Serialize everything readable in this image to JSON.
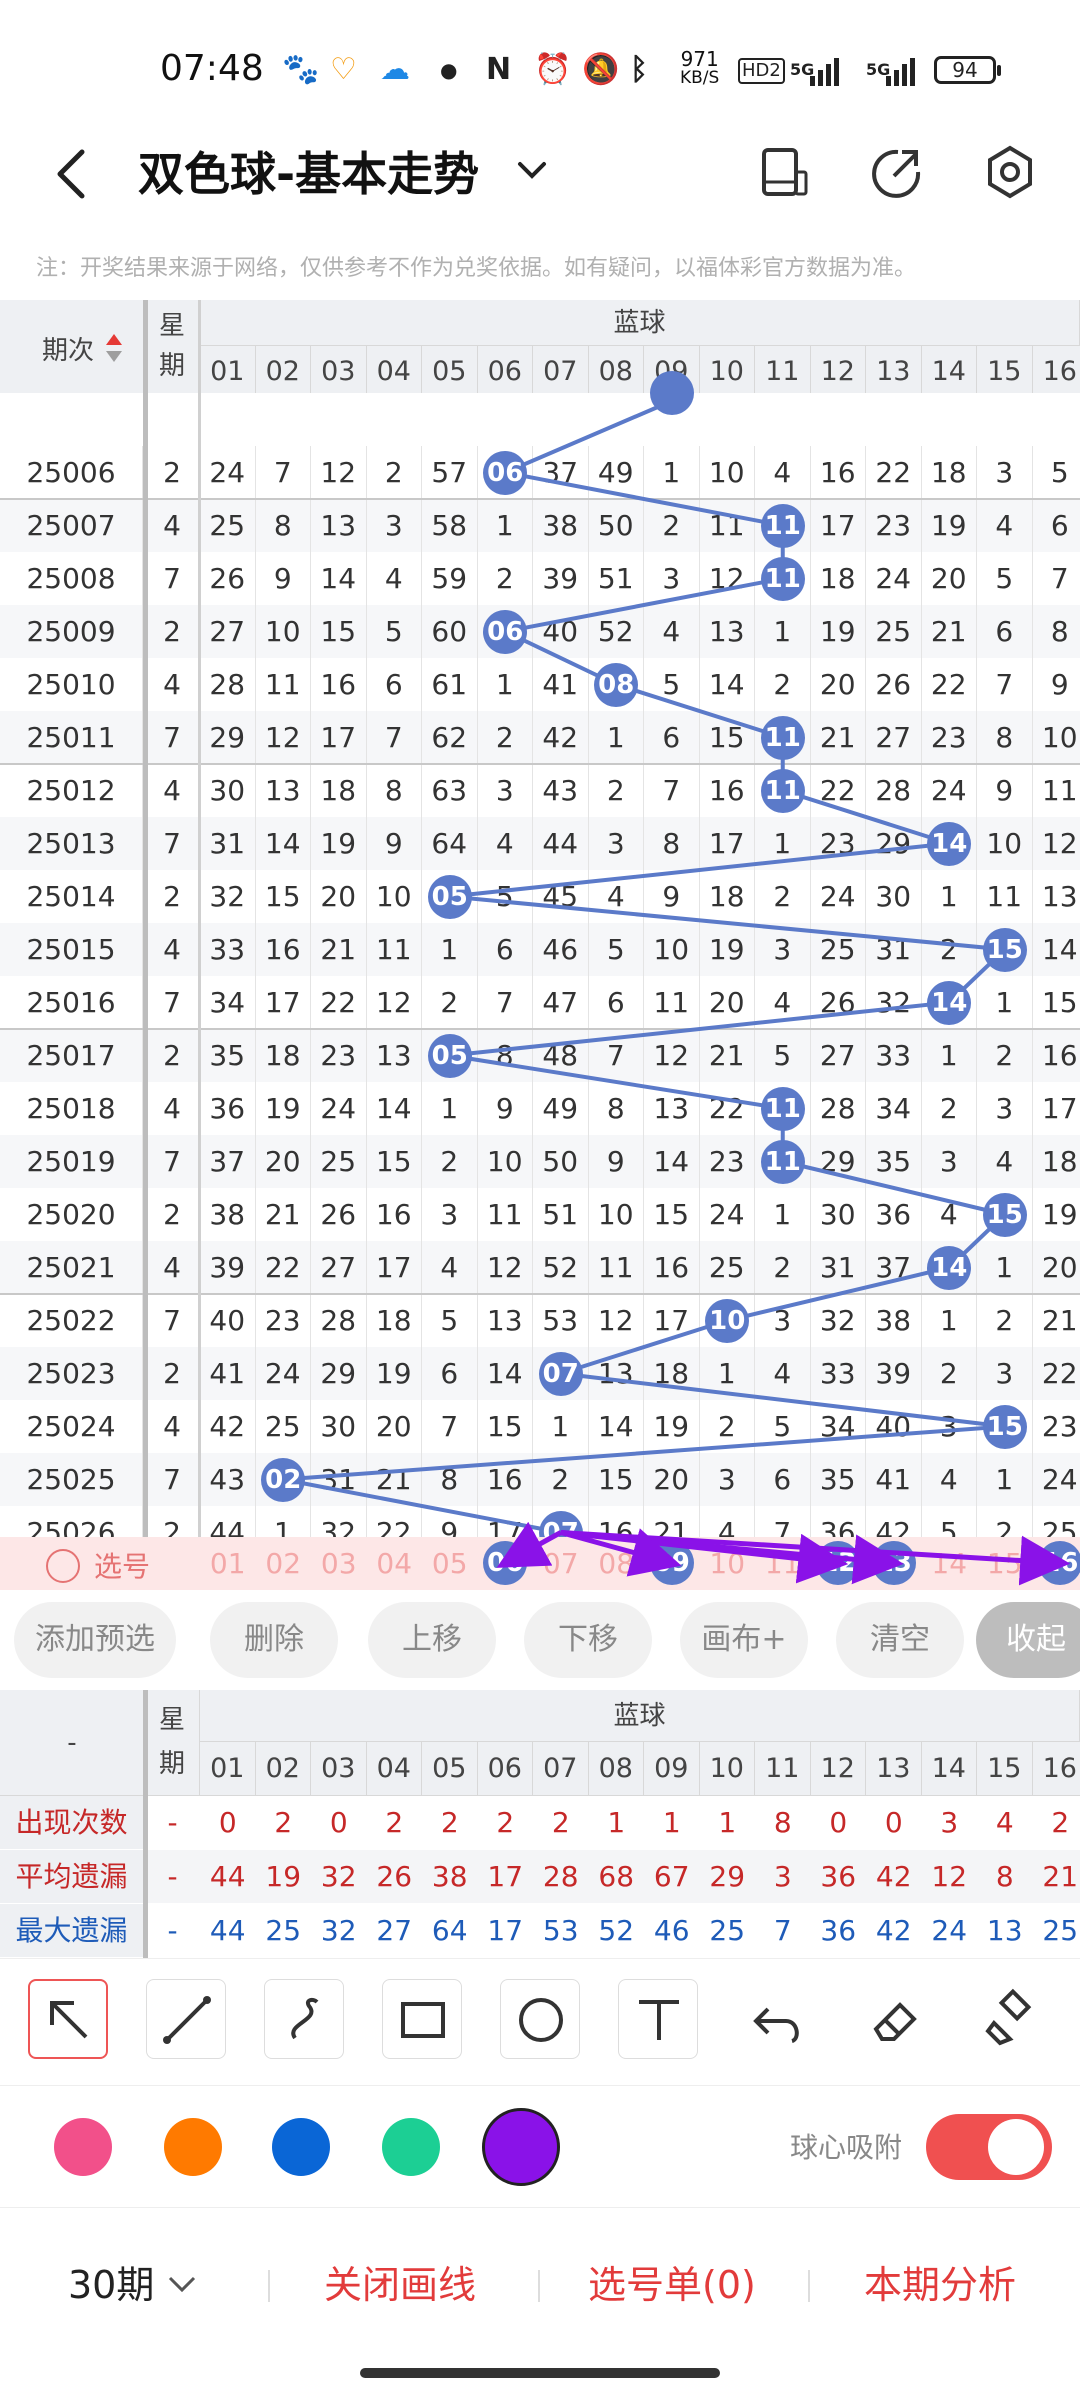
{
  "status": {
    "time": "07:48",
    "speed_value": "971",
    "speed_unit": "KB/S",
    "hd": "HD2",
    "net1": "5G",
    "net2": "5G",
    "battery": "94"
  },
  "header": {
    "title": "双色球-基本走势"
  },
  "note": "注：开奖结果来源于网络，仅供参考不作为兑奖依据。如有疑问，以福体彩官方数据为准。",
  "table": {
    "col_issue": "期次",
    "col_week_top": "星",
    "col_week_bottom": "期",
    "blue_title": "蓝球",
    "columns": [
      "01",
      "02",
      "03",
      "04",
      "05",
      "06",
      "07",
      "08",
      "09",
      "10",
      "11",
      "12",
      "13",
      "14",
      "15",
      "16"
    ],
    "rows": [
      {
        "issue": "25006",
        "week": "2",
        "cells": [
          "24",
          "7",
          "12",
          "2",
          "57",
          "06",
          "37",
          "49",
          "1",
          "10",
          "4",
          "16",
          "22",
          "18",
          "3",
          "5"
        ],
        "hit": 6
      },
      {
        "issue": "25007",
        "week": "4",
        "cells": [
          "25",
          "8",
          "13",
          "3",
          "58",
          "1",
          "38",
          "50",
          "2",
          "11",
          "11",
          "17",
          "23",
          "19",
          "4",
          "6"
        ],
        "hit": 11
      },
      {
        "issue": "25008",
        "week": "7",
        "cells": [
          "26",
          "9",
          "14",
          "4",
          "59",
          "2",
          "39",
          "51",
          "3",
          "12",
          "11",
          "18",
          "24",
          "20",
          "5",
          "7"
        ],
        "hit": 11
      },
      {
        "issue": "25009",
        "week": "2",
        "cells": [
          "27",
          "10",
          "15",
          "5",
          "60",
          "06",
          "40",
          "52",
          "4",
          "13",
          "1",
          "19",
          "25",
          "21",
          "6",
          "8"
        ],
        "hit": 6
      },
      {
        "issue": "25010",
        "week": "4",
        "cells": [
          "28",
          "11",
          "16",
          "6",
          "61",
          "1",
          "41",
          "08",
          "5",
          "14",
          "2",
          "20",
          "26",
          "22",
          "7",
          "9"
        ],
        "hit": 8
      },
      {
        "issue": "25011",
        "week": "7",
        "cells": [
          "29",
          "12",
          "17",
          "7",
          "62",
          "2",
          "42",
          "1",
          "6",
          "15",
          "11",
          "21",
          "27",
          "23",
          "8",
          "10"
        ],
        "hit": 11
      },
      {
        "issue": "25012",
        "week": "4",
        "cells": [
          "30",
          "13",
          "18",
          "8",
          "63",
          "3",
          "43",
          "2",
          "7",
          "16",
          "11",
          "22",
          "28",
          "24",
          "9",
          "11"
        ],
        "hit": 11
      },
      {
        "issue": "25013",
        "week": "7",
        "cells": [
          "31",
          "14",
          "19",
          "9",
          "64",
          "4",
          "44",
          "3",
          "8",
          "17",
          "1",
          "23",
          "29",
          "14",
          "10",
          "12"
        ],
        "hit": 14
      },
      {
        "issue": "25014",
        "week": "2",
        "cells": [
          "32",
          "15",
          "20",
          "10",
          "05",
          "5",
          "45",
          "4",
          "9",
          "18",
          "2",
          "24",
          "30",
          "1",
          "11",
          "13"
        ],
        "hit": 5
      },
      {
        "issue": "25015",
        "week": "4",
        "cells": [
          "33",
          "16",
          "21",
          "11",
          "1",
          "6",
          "46",
          "5",
          "10",
          "19",
          "3",
          "25",
          "31",
          "2",
          "15",
          "14"
        ],
        "hit": 15
      },
      {
        "issue": "25016",
        "week": "7",
        "cells": [
          "34",
          "17",
          "22",
          "12",
          "2",
          "7",
          "47",
          "6",
          "11",
          "20",
          "4",
          "26",
          "32",
          "14",
          "1",
          "15"
        ],
        "hit": 14
      },
      {
        "issue": "25017",
        "week": "2",
        "cells": [
          "35",
          "18",
          "23",
          "13",
          "05",
          "8",
          "48",
          "7",
          "12",
          "21",
          "5",
          "27",
          "33",
          "1",
          "2",
          "16"
        ],
        "hit": 5
      },
      {
        "issue": "25018",
        "week": "4",
        "cells": [
          "36",
          "19",
          "24",
          "14",
          "1",
          "9",
          "49",
          "8",
          "13",
          "22",
          "11",
          "28",
          "34",
          "2",
          "3",
          "17"
        ],
        "hit": 11
      },
      {
        "issue": "25019",
        "week": "7",
        "cells": [
          "37",
          "20",
          "25",
          "15",
          "2",
          "10",
          "50",
          "9",
          "14",
          "23",
          "11",
          "29",
          "35",
          "3",
          "4",
          "18"
        ],
        "hit": 11
      },
      {
        "issue": "25020",
        "week": "2",
        "cells": [
          "38",
          "21",
          "26",
          "16",
          "3",
          "11",
          "51",
          "10",
          "15",
          "24",
          "1",
          "30",
          "36",
          "4",
          "15",
          "19"
        ],
        "hit": 15
      },
      {
        "issue": "25021",
        "week": "4",
        "cells": [
          "39",
          "22",
          "27",
          "17",
          "4",
          "12",
          "52",
          "11",
          "16",
          "25",
          "2",
          "31",
          "37",
          "14",
          "1",
          "20"
        ],
        "hit": 14
      },
      {
        "issue": "25022",
        "week": "7",
        "cells": [
          "40",
          "23",
          "28",
          "18",
          "5",
          "13",
          "53",
          "12",
          "17",
          "10",
          "3",
          "32",
          "38",
          "1",
          "2",
          "21"
        ],
        "hit": 10
      },
      {
        "issue": "25023",
        "week": "2",
        "cells": [
          "41",
          "24",
          "29",
          "19",
          "6",
          "14",
          "07",
          "13",
          "18",
          "1",
          "4",
          "33",
          "39",
          "2",
          "3",
          "22"
        ],
        "hit": 7
      },
      {
        "issue": "25024",
        "week": "4",
        "cells": [
          "42",
          "25",
          "30",
          "20",
          "7",
          "15",
          "1",
          "14",
          "19",
          "2",
          "5",
          "34",
          "40",
          "3",
          "15",
          "23"
        ],
        "hit": 15
      },
      {
        "issue": "25025",
        "week": "7",
        "cells": [
          "43",
          "02",
          "31",
          "21",
          "8",
          "16",
          "2",
          "15",
          "20",
          "3",
          "6",
          "35",
          "41",
          "4",
          "1",
          "24"
        ],
        "hit": 2
      },
      {
        "issue": "25026",
        "week": "2",
        "cells": [
          "44",
          "1",
          "32",
          "22",
          "9",
          "17",
          "07",
          "16",
          "21",
          "4",
          "7",
          "36",
          "42",
          "5",
          "2",
          "25"
        ],
        "hit": 7
      }
    ],
    "pick_label": "选号",
    "pick_numbers": [
      "01",
      "02",
      "03",
      "04",
      "05",
      "06",
      "07",
      "08",
      "09",
      "10",
      "11",
      "12",
      "13",
      "14",
      "15",
      "16"
    ],
    "picked": [
      6,
      9,
      12,
      13,
      16
    ]
  },
  "buttons": [
    "添加预选",
    "删除",
    "上移",
    "下移",
    "画布+",
    "清空",
    "收起"
  ],
  "stats": {
    "corner": "-",
    "week_top": "星",
    "week_bottom": "期",
    "blue_title": "蓝球",
    "rows": [
      {
        "label": "出现次数",
        "dash": "-",
        "values": [
          "0",
          "2",
          "0",
          "2",
          "2",
          "2",
          "2",
          "1",
          "1",
          "1",
          "8",
          "0",
          "0",
          "3",
          "4",
          "2"
        ]
      },
      {
        "label": "平均遗漏",
        "dash": "-",
        "values": [
          "44",
          "19",
          "32",
          "26",
          "38",
          "17",
          "28",
          "68",
          "67",
          "29",
          "3",
          "36",
          "42",
          "12",
          "8",
          "21"
        ]
      },
      {
        "label": "最大遗漏",
        "dash": "-",
        "values": [
          "44",
          "25",
          "32",
          "27",
          "64",
          "17",
          "53",
          "52",
          "46",
          "25",
          "7",
          "36",
          "42",
          "24",
          "13",
          "25"
        ]
      }
    ]
  },
  "tools": [
    "arrow-tool",
    "line-tool",
    "curve-tool",
    "rect-tool",
    "circle-tool",
    "text-tool",
    "undo-tool",
    "eraser-tool",
    "clear-brush-tool"
  ],
  "colors": [
    "#f2508a",
    "#ff7a00",
    "#0a66d6",
    "#1ccf94",
    "#8a12e8"
  ],
  "snap_label": "球心吸附",
  "footer": {
    "periods": "30期",
    "close_lines": "关闭画线",
    "pick_list": "选号单(0)",
    "analysis": "本期分析"
  }
}
